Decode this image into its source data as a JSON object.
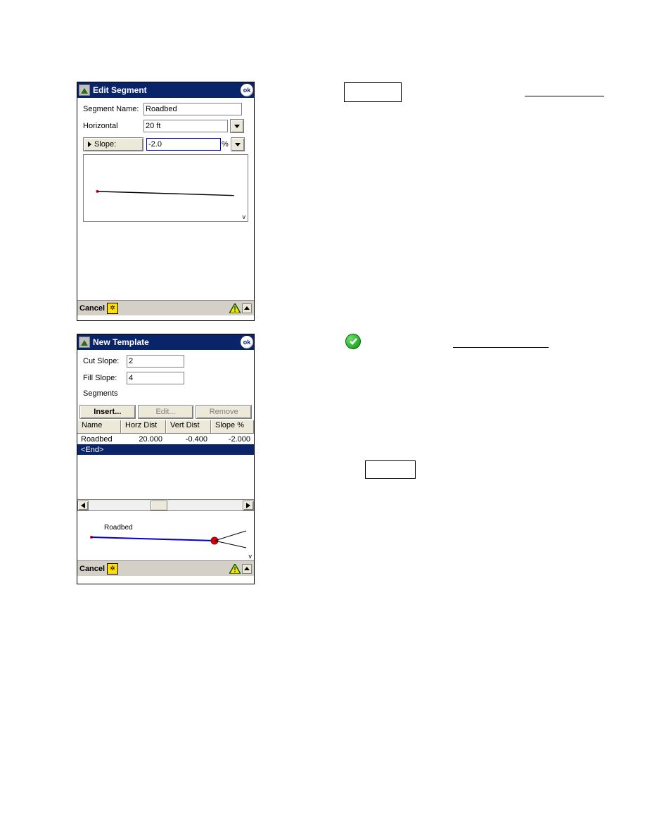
{
  "dialog1": {
    "title": "Edit Segment",
    "ok": "ok",
    "segment_name_label": "Segment Name:",
    "segment_name_value": "Roadbed",
    "horizontal_label": "Horizontal",
    "horizontal_value": "20 ft",
    "slope_label": "Slope:",
    "slope_value": "-2.0",
    "slope_unit": "%",
    "preview_v": "v",
    "cancel": "Cancel"
  },
  "dialog2": {
    "title": "New Template",
    "ok": "ok",
    "cut_slope_label": "Cut Slope:",
    "cut_slope_value": "2",
    "fill_slope_label": "Fill Slope:",
    "fill_slope_value": "4",
    "segments_label": "Segments",
    "buttons": {
      "insert": "Insert...",
      "edit": "Edit...",
      "remove": "Remove"
    },
    "columns": {
      "name": "Name",
      "horz": "Horz Dist",
      "vert": "Vert Dist",
      "slope": "Slope %"
    },
    "rows": [
      {
        "name": "Roadbed",
        "horz": "20.000",
        "vert": "-0.400",
        "slope": "-2.000"
      },
      {
        "name": "<End>",
        "horz": "",
        "vert": "",
        "slope": ""
      }
    ],
    "preview_label": "Roadbed",
    "preview_v": "v",
    "cancel": "Cancel"
  }
}
